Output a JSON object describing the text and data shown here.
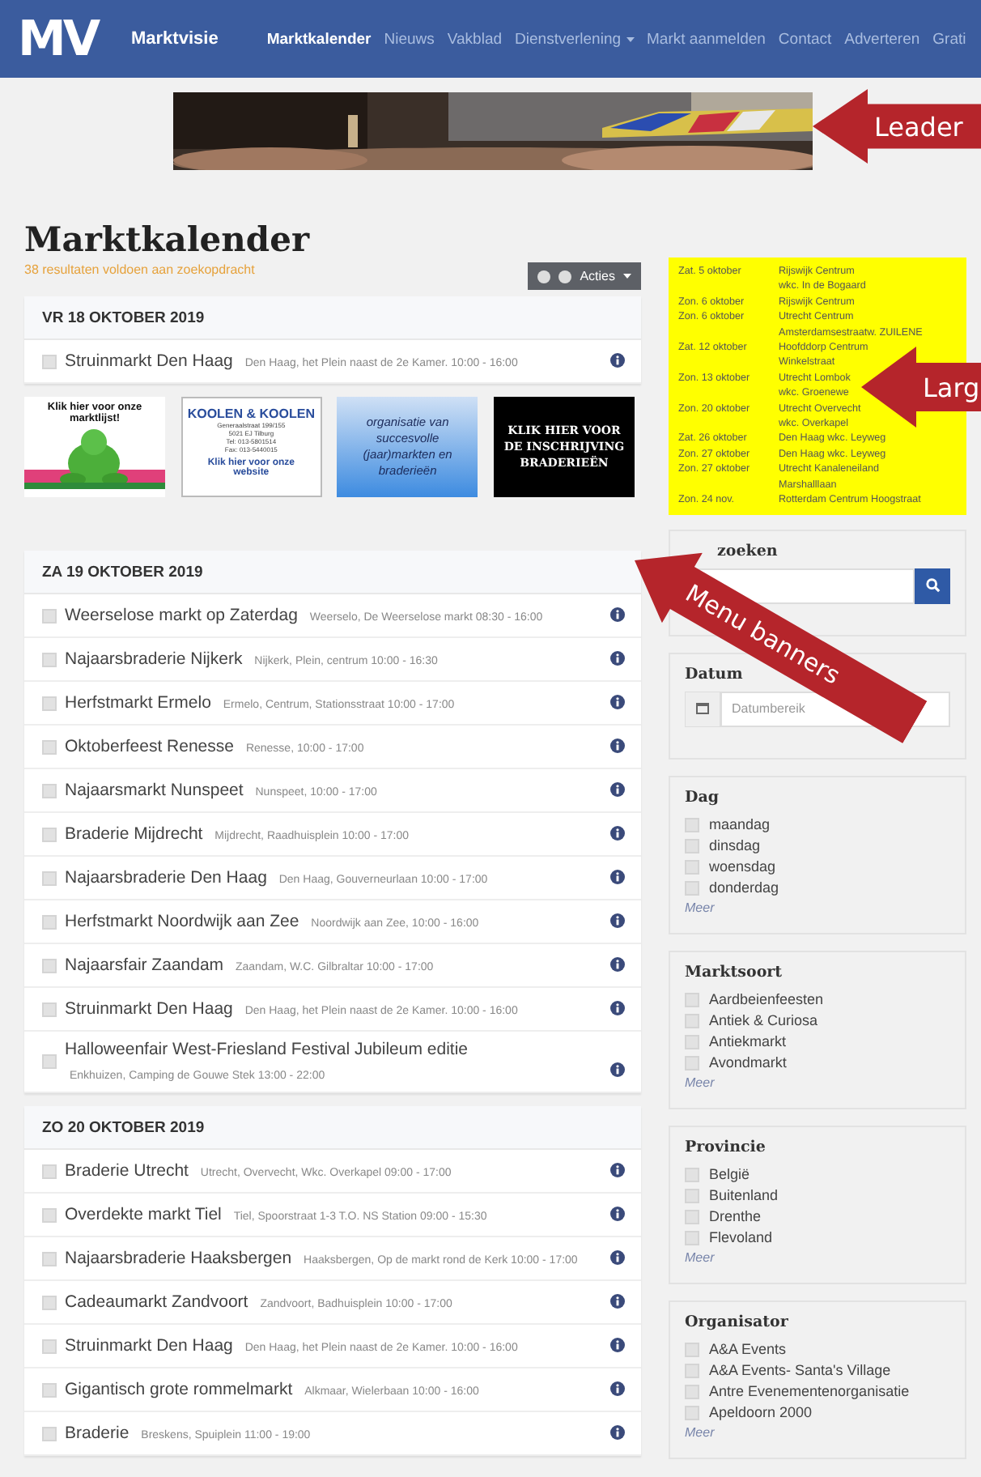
{
  "nav": {
    "logo": "MV",
    "brand": "Marktvisie",
    "items": [
      {
        "label": "Marktkalender",
        "selected": true,
        "dropdown": false
      },
      {
        "label": "Nieuws",
        "selected": false,
        "dropdown": false
      },
      {
        "label": "Vakblad",
        "selected": false,
        "dropdown": false
      },
      {
        "label": "Dienstverlening",
        "selected": false,
        "dropdown": true
      },
      {
        "label": "Markt aanmelden",
        "selected": false,
        "dropdown": false
      },
      {
        "label": "Contact",
        "selected": false,
        "dropdown": false
      },
      {
        "label": "Adverteren",
        "selected": false,
        "dropdown": false
      },
      {
        "label": "Grati",
        "selected": false,
        "dropdown": false
      }
    ]
  },
  "annotations": [
    {
      "label": "Leader"
    },
    {
      "label": "Larg"
    },
    {
      "label": "Menu banners"
    }
  ],
  "page": {
    "title": "Marktkalender",
    "result_count": "38 resultaten voldoen aan zoekopdracht",
    "actions_button": "Acties"
  },
  "sections": [
    {
      "kind": "day",
      "heading": "VR 18 OKTOBER 2019",
      "events": [
        {
          "name": "Struinmarkt Den Haag",
          "details": "Den Haag, het Plein naast de 2e Kamer. 10:00 - 16:00",
          "checked": false
        }
      ]
    },
    {
      "kind": "banners",
      "items": [
        {
          "kind": "frog",
          "heading": "Klik hier voor onze marktlijst!"
        },
        {
          "kind": "koolen",
          "heading": "KOOLEN & KOOLEN",
          "lines": [
            "Generaalstraat 199/155",
            "5021 EJ Tilburg",
            "Tel: 013-5801514",
            "Fax: 013-5440015"
          ],
          "link": "Klik hier voor onze website"
        },
        {
          "kind": "gradient",
          "heading": "organisatie van succesvolle (jaar)markten en braderieën"
        },
        {
          "kind": "black",
          "heading": "KLIK HIER VOOR DE INSCHRIJVING BRADERIEËN"
        }
      ]
    },
    {
      "kind": "day",
      "heading": "ZA 19 OKTOBER 2019",
      "events": [
        {
          "name": "Weerselose markt op Zaterdag",
          "details": "Weerselo, De Weerselose markt 08:30 - 16:00",
          "checked": false
        },
        {
          "name": "Najaarsbraderie Nijkerk",
          "details": "Nijkerk, Plein, centrum 10:00 - 16:30",
          "checked": false
        },
        {
          "name": "Herfstmarkt Ermelo",
          "details": "Ermelo, Centrum, Stationsstraat 10:00 - 17:00",
          "checked": false
        },
        {
          "name": "Oktoberfeest Renesse",
          "details": "Renesse, 10:00 - 17:00",
          "checked": false
        },
        {
          "name": "Najaarsmarkt Nunspeet",
          "details": "Nunspeet, 10:00 - 17:00",
          "checked": false
        },
        {
          "name": "Braderie Mijdrecht",
          "details": "Mijdrecht, Raadhuisplein 10:00 - 17:00",
          "checked": false
        },
        {
          "name": "Najaarsbraderie Den Haag",
          "details": "Den Haag, Gouverneurlaan 10:00 - 17:00",
          "checked": false
        },
        {
          "name": "Herfstmarkt Noordwijk aan Zee",
          "details": "Noordwijk aan Zee, 10:00 - 16:00",
          "checked": false
        },
        {
          "name": "Najaarsfair Zaandam",
          "details": "Zaandam, W.C. Gilbraltar 10:00 - 17:00",
          "checked": false
        },
        {
          "name": "Struinmarkt Den Haag",
          "details": "Den Haag, het Plein naast de 2e Kamer. 10:00 - 16:00",
          "checked": false
        },
        {
          "name": "Halloweenfair West-Friesland Festival Jubileum editie",
          "details": "Enkhuizen, Camping de Gouwe Stek 13:00 - 22:00",
          "checked": false
        }
      ]
    },
    {
      "kind": "day",
      "heading": "ZO 20 OKTOBER 2019",
      "events": [
        {
          "name": "Braderie Utrecht",
          "details": "Utrecht, Overvecht, Wkc. Overkapel 09:00 - 17:00",
          "checked": false
        },
        {
          "name": "Overdekte markt Tiel",
          "details": "Tiel, Spoorstraat 1-3 T.O. NS Station 09:00 - 15:30",
          "checked": false
        },
        {
          "name": "Najaarsbraderie Haaksbergen",
          "details": "Haaksbergen, Op de markt rond de Kerk 10:00 - 17:00",
          "checked": false
        },
        {
          "name": "Cadeaumarkt Zandvoort",
          "details": "Zandvoort, Badhuisplein 10:00 - 17:00",
          "checked": false
        },
        {
          "name": "Struinmarkt Den Haag",
          "details": "Den Haag, het Plein naast de 2e Kamer. 10:00 - 16:00",
          "checked": false
        },
        {
          "name": "Gigantisch grote rommelmarkt",
          "details": "Alkmaar, Wielerbaan 10:00 - 16:00",
          "checked": false
        },
        {
          "name": "Braderie",
          "details": "Breskens, Spuiplein 11:00 - 19:00",
          "checked": false
        }
      ]
    }
  ],
  "sidebar": {
    "schedule": [
      {
        "date": "Zat. 5 oktober",
        "place": [
          "Rijswijk Centrum",
          "wkc. In de Bogaard"
        ]
      },
      {
        "date": "Zon. 6 oktober",
        "place": [
          "Rijswijk Centrum"
        ]
      },
      {
        "date": "Zon. 6 oktober",
        "place": [
          "Utrecht Centrum",
          "Amsterdamsestraatw. ZUILENE"
        ]
      },
      {
        "date": "Zat. 12 oktober",
        "place": [
          "Hoofddorp Centrum",
          "Winkelstraat"
        ]
      },
      {
        "date": "Zon. 13 oktober",
        "place": [
          "Utrecht Lombok",
          "wkc. Groenewe"
        ]
      },
      {
        "date": "Zon. 20 oktober",
        "place": [
          "Utrecht Overvecht",
          "wkc. Overkapel"
        ]
      },
      {
        "date": "Zat. 26 oktober",
        "place": [
          "Den Haag wkc. Leyweg"
        ]
      },
      {
        "date": "Zon. 27 oktober",
        "place": [
          "Den Haag wkc. Leyweg"
        ]
      },
      {
        "date": "Zon. 27 oktober",
        "place": [
          "Utrecht Kanaleneiland",
          "Marshalllaan"
        ]
      },
      {
        "date": "Zon. 24 nov.",
        "place": [
          "Rotterdam Centrum Hoogstraat"
        ]
      }
    ],
    "search": {
      "title": "zoeken"
    },
    "date": {
      "title": "Datum",
      "placeholder": "Datumbereik"
    },
    "filters": [
      {
        "title": "Dag",
        "more": "Meer",
        "options": [
          {
            "label": "maandag",
            "checked": false
          },
          {
            "label": "dinsdag",
            "checked": false
          },
          {
            "label": "woensdag",
            "checked": false
          },
          {
            "label": "donderdag",
            "checked": false
          }
        ]
      },
      {
        "title": "Marktsoort",
        "more": "Meer",
        "options": [
          {
            "label": "Aardbeienfeesten",
            "checked": false
          },
          {
            "label": "Antiek & Curiosa",
            "checked": false
          },
          {
            "label": "Antiekmarkt",
            "checked": false
          },
          {
            "label": "Avondmarkt",
            "checked": false
          }
        ]
      },
      {
        "title": "Provincie",
        "more": "Meer",
        "options": [
          {
            "label": "België",
            "checked": false
          },
          {
            "label": "Buitenland",
            "checked": false
          },
          {
            "label": "Drenthe",
            "checked": false
          },
          {
            "label": "Flevoland",
            "checked": false
          }
        ]
      },
      {
        "title": "Organisator",
        "more": "Meer",
        "options": [
          {
            "label": "A&A Events",
            "checked": false
          },
          {
            "label": "A&A Events- Santa's Village",
            "checked": false
          },
          {
            "label": "Antre Evenementenorganisatie",
            "checked": false
          },
          {
            "label": "Apeldoorn 2000",
            "checked": false
          }
        ]
      }
    ]
  }
}
